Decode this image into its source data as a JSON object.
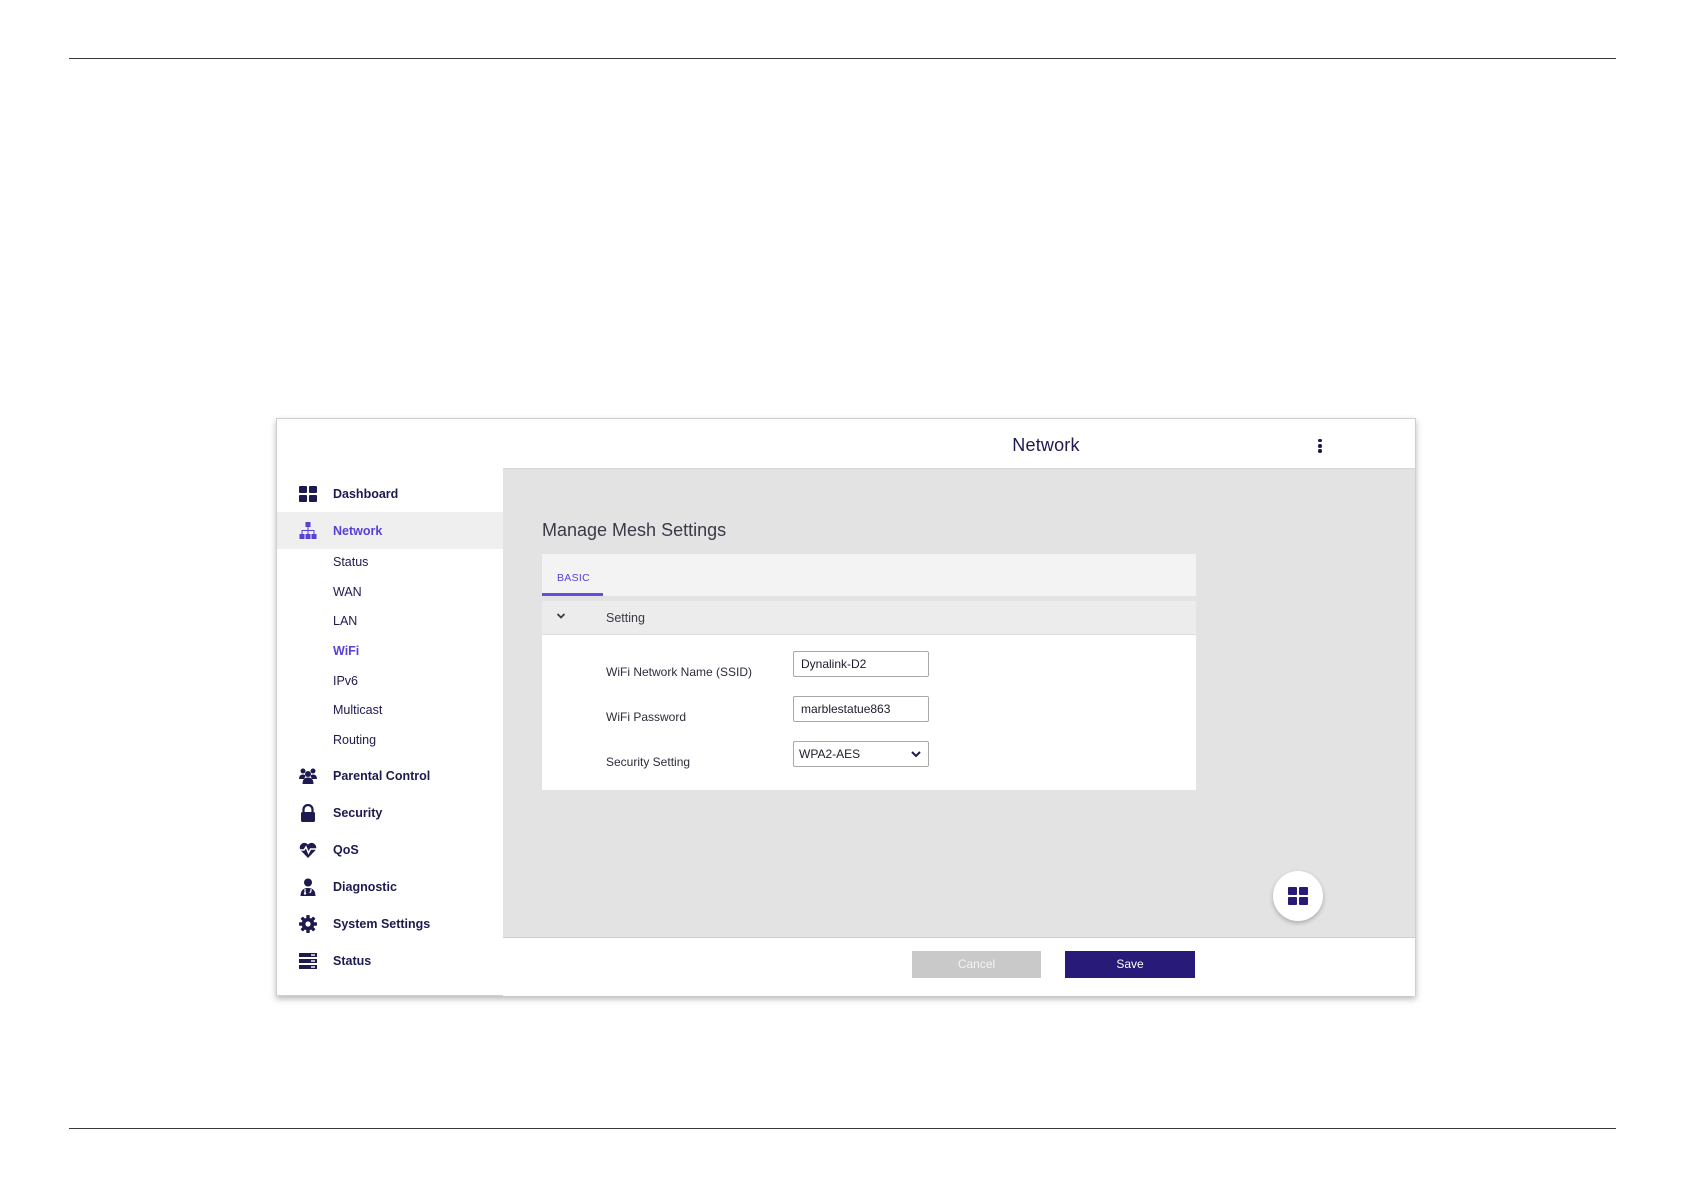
{
  "header": {
    "title": "Network"
  },
  "sidebar": {
    "items": [
      {
        "label": "Dashboard",
        "icon": "dashboard-icon"
      },
      {
        "label": "Network",
        "icon": "network-icon"
      },
      {
        "label": "Parental Control",
        "icon": "parental-control-icon"
      },
      {
        "label": "Security",
        "icon": "lock-icon"
      },
      {
        "label": "QoS",
        "icon": "heart-pulse-icon"
      },
      {
        "label": "Diagnostic",
        "icon": "doctor-icon"
      },
      {
        "label": "System Settings",
        "icon": "gear-icon"
      },
      {
        "label": "Status",
        "icon": "server-icon"
      }
    ],
    "network_sub": [
      "Status",
      "WAN",
      "LAN",
      "WiFi",
      "IPv6",
      "Multicast",
      "Routing"
    ],
    "active_item": "Network",
    "active_sub": "WiFi"
  },
  "main": {
    "heading": "Manage Mesh Settings",
    "tabs": [
      {
        "label": "BASIC"
      }
    ],
    "panel": {
      "title": "Setting",
      "fields": [
        {
          "label": "WiFi Network Name (SSID)",
          "value": "Dynalink-D2"
        },
        {
          "label": "WiFi Password",
          "value": "marblestatue863"
        },
        {
          "label": "Security Setting",
          "value": "WPA2-AES"
        }
      ]
    }
  },
  "footer": {
    "cancel_label": "Cancel",
    "save_label": "Save"
  },
  "colors": {
    "accent": "#5a3fd6",
    "navy": "#1d1a4f",
    "save_button": "#271a79",
    "content_bg": "#e3e3e3"
  }
}
